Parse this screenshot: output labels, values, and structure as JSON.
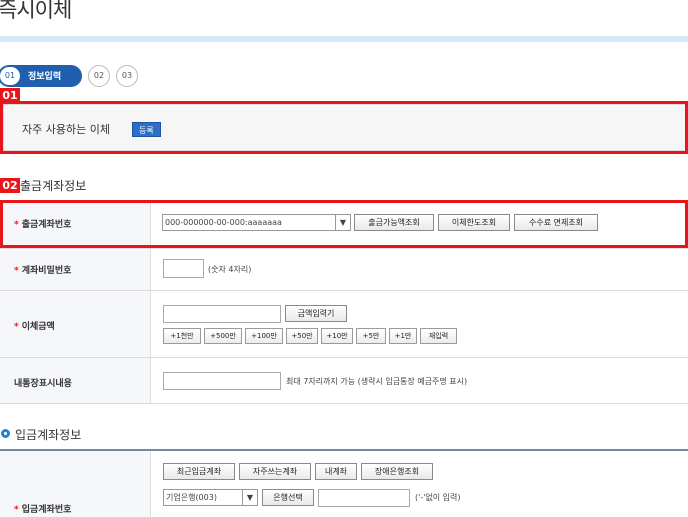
{
  "page": {
    "title": "즉시이체"
  },
  "steps": {
    "active_num": "01",
    "active_label": "정보입력",
    "step2": "02",
    "step3": "03"
  },
  "annotations": {
    "box1": "01",
    "box2": "02"
  },
  "favorites": {
    "label": "자주 사용하는 이체",
    "register_button": "등록"
  },
  "withdraw_section": {
    "title": "출금계좌정보",
    "account_label": "출금계좌번호",
    "account_select": "000-000000-00-000:aaaaaaa",
    "btn_available": "출금가능액조회",
    "btn_limit": "이체한도조회",
    "btn_fee": "수수료 면제조회",
    "password_label": "계좌비밀번호",
    "password_hint": "(숫자 4자리)",
    "amount_label": "이체금액",
    "amount_input_button": "금액입력기",
    "amount_buttons": [
      "+1천만",
      "+500만",
      "+100만",
      "+50만",
      "+10만",
      "+5만",
      "+1만",
      "재입력"
    ],
    "memo_label": "내통장표시내용",
    "memo_hint": "최대 7자리까지 가능 (생략시 입금통장 예금주명 표시)"
  },
  "deposit_section": {
    "title": "입금계좌정보",
    "account_label": "입금계좌번호",
    "btn_recent": "최근입금계좌",
    "btn_frequent": "자주쓰는계좌",
    "btn_my": "내계좌",
    "btn_bank_error": "장애은행조회",
    "bank_select": "기업은행(003)",
    "btn_select_bank": "은행선택",
    "account_hint": "('-'없이 입력)"
  },
  "colors": {
    "accent": "#1f5fae",
    "annotation_red": "#e8161a",
    "required": "#e8161a"
  }
}
